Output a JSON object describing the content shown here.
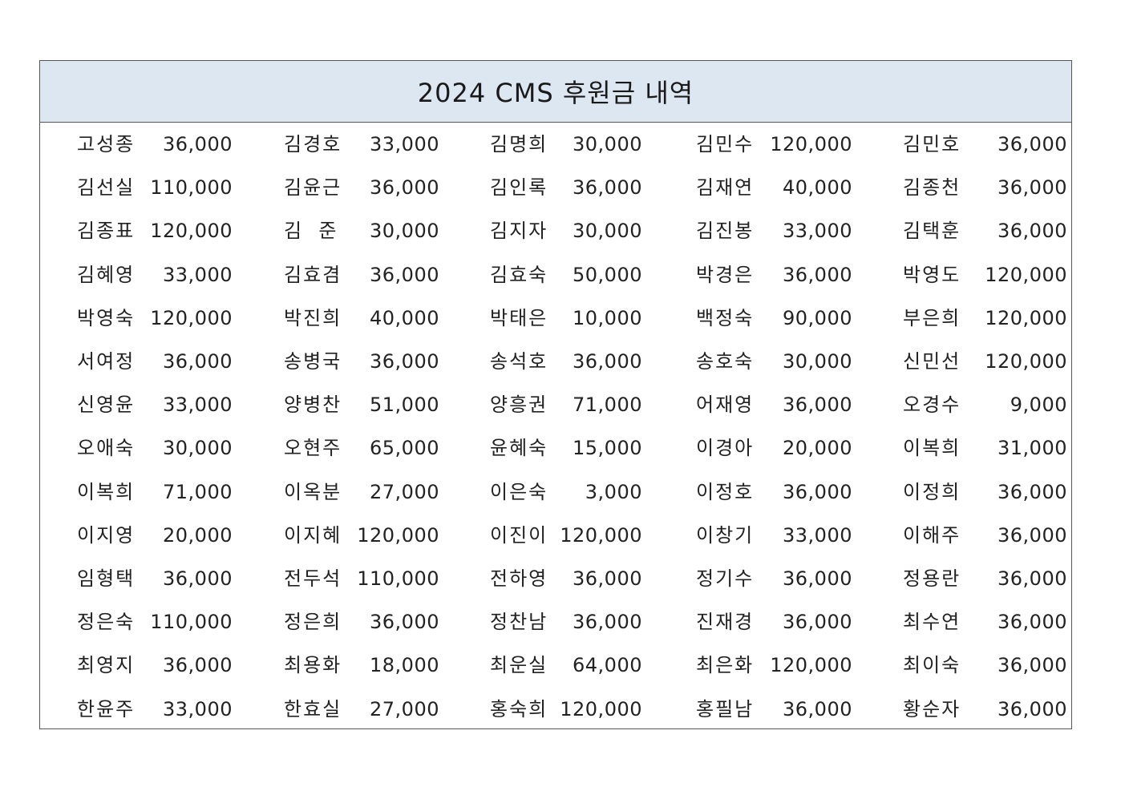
{
  "document": {
    "title": "2024 CMS 후원금 내역"
  },
  "rows": [
    [
      [
        "고성종",
        "36,000"
      ],
      [
        "김경호",
        "33,000"
      ],
      [
        "김명희",
        "30,000"
      ],
      [
        "김민수",
        "120,000"
      ],
      [
        "김민호",
        "36,000"
      ]
    ],
    [
      [
        "김선실",
        "110,000"
      ],
      [
        "김윤근",
        "36,000"
      ],
      [
        "김인록",
        "36,000"
      ],
      [
        "김재연",
        "40,000"
      ],
      [
        "김종천",
        "36,000"
      ]
    ],
    [
      [
        "김종표",
        "120,000"
      ],
      [
        "김  준",
        "30,000"
      ],
      [
        "김지자",
        "30,000"
      ],
      [
        "김진봉",
        "33,000"
      ],
      [
        "김택훈",
        "36,000"
      ]
    ],
    [
      [
        "김혜영",
        "33,000"
      ],
      [
        "김효겸",
        "36,000"
      ],
      [
        "김효숙",
        "50,000"
      ],
      [
        "박경은",
        "36,000"
      ],
      [
        "박영도",
        "120,000"
      ]
    ],
    [
      [
        "박영숙",
        "120,000"
      ],
      [
        "박진희",
        "40,000"
      ],
      [
        "박태은",
        "10,000"
      ],
      [
        "백정숙",
        "90,000"
      ],
      [
        "부은희",
        "120,000"
      ]
    ],
    [
      [
        "서여정",
        "36,000"
      ],
      [
        "송병국",
        "36,000"
      ],
      [
        "송석호",
        "36,000"
      ],
      [
        "송호숙",
        "30,000"
      ],
      [
        "신민선",
        "120,000"
      ]
    ],
    [
      [
        "신영윤",
        "33,000"
      ],
      [
        "양병찬",
        "51,000"
      ],
      [
        "양흥권",
        "71,000"
      ],
      [
        "어재영",
        "36,000"
      ],
      [
        "오경수",
        "9,000"
      ]
    ],
    [
      [
        "오애숙",
        "30,000"
      ],
      [
        "오현주",
        "65,000"
      ],
      [
        "윤혜숙",
        "15,000"
      ],
      [
        "이경아",
        "20,000"
      ],
      [
        "이복희",
        "31,000"
      ]
    ],
    [
      [
        "이복희",
        "71,000"
      ],
      [
        "이옥분",
        "27,000"
      ],
      [
        "이은숙",
        "3,000"
      ],
      [
        "이정호",
        "36,000"
      ],
      [
        "이정희",
        "36,000"
      ]
    ],
    [
      [
        "이지영",
        "20,000"
      ],
      [
        "이지혜",
        "120,000"
      ],
      [
        "이진이",
        "120,000"
      ],
      [
        "이창기",
        "33,000"
      ],
      [
        "이해주",
        "36,000"
      ]
    ],
    [
      [
        "임형택",
        "36,000"
      ],
      [
        "전두석",
        "110,000"
      ],
      [
        "전하영",
        "36,000"
      ],
      [
        "정기수",
        "36,000"
      ],
      [
        "정용란",
        "36,000"
      ]
    ],
    [
      [
        "정은숙",
        "110,000"
      ],
      [
        "정은희",
        "36,000"
      ],
      [
        "정찬남",
        "36,000"
      ],
      [
        "진재경",
        "36,000"
      ],
      [
        "최수연",
        "36,000"
      ]
    ],
    [
      [
        "최영지",
        "36,000"
      ],
      [
        "최용화",
        "18,000"
      ],
      [
        "최운실",
        "64,000"
      ],
      [
        "최은화",
        "120,000"
      ],
      [
        "최이숙",
        "36,000"
      ]
    ],
    [
      [
        "한윤주",
        "33,000"
      ],
      [
        "한효실",
        "27,000"
      ],
      [
        "홍숙희",
        "120,000"
      ],
      [
        "홍필남",
        "36,000"
      ],
      [
        "황순자",
        "36,000"
      ]
    ]
  ]
}
